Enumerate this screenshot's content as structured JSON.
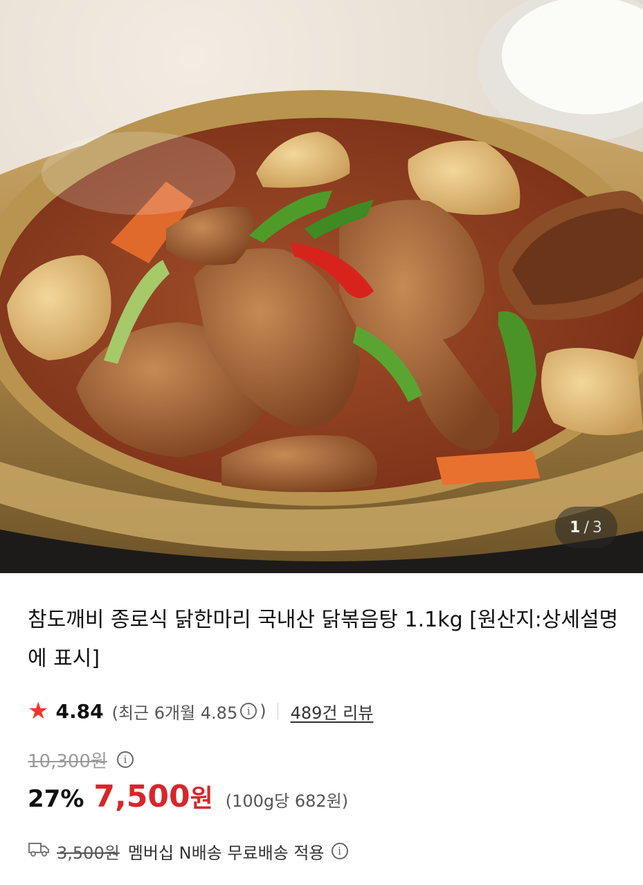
{
  "gallery": {
    "image_alt": "닭볶음탕 product photo",
    "current": "1",
    "separator": "/",
    "total": "3"
  },
  "product": {
    "title": "참도깨비 종로식 닭한마리 국내산 닭볶음탕 1.1kg [원산지:상세설명에 표시]"
  },
  "rating": {
    "star_icon": "star-icon",
    "score": "4.84",
    "recent_prefix": "(최근 6개월 4.85",
    "recent_suffix": ")",
    "info_icon": "info-icon",
    "reviews": "489건 리뷰"
  },
  "price": {
    "original": "10,300원",
    "discount": "27%",
    "sale": "7,500",
    "currency": "원",
    "unit_price": "(100g당 682원)"
  },
  "shipping": {
    "icon": "truck-icon",
    "old_fee": "3,500원",
    "text": "멤버십 N배송 무료배송 적용"
  },
  "colors": {
    "accent_red": "#d8262b",
    "star_red": "#f0362b"
  }
}
